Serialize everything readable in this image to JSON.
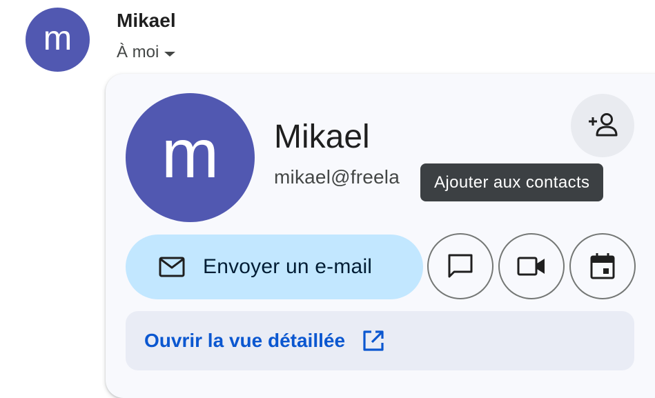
{
  "sender": {
    "initial": "m",
    "name": "Mikael",
    "recipient_label": "À moi"
  },
  "hovercard": {
    "initial": "m",
    "name": "Mikael",
    "email": "mikael@freela",
    "add_contact_tooltip": "Ajouter aux contacts",
    "send_email_label": "Envoyer un e-mail",
    "detail_view_label": "Ouvrir la vue détaillée"
  },
  "icons": {
    "add_contact": "person-add-icon",
    "mail": "mail-icon",
    "chat": "chat-icon",
    "video": "videocam-icon",
    "calendar": "calendar-icon",
    "open_external": "open-in-new-icon",
    "caret": "caret-down-icon"
  },
  "colors": {
    "avatar": "#5158b1",
    "primary_button": "#c2e7ff",
    "link": "#0b57d0",
    "tooltip_bg": "#3c4043",
    "card_bg": "#f8f9fd"
  }
}
